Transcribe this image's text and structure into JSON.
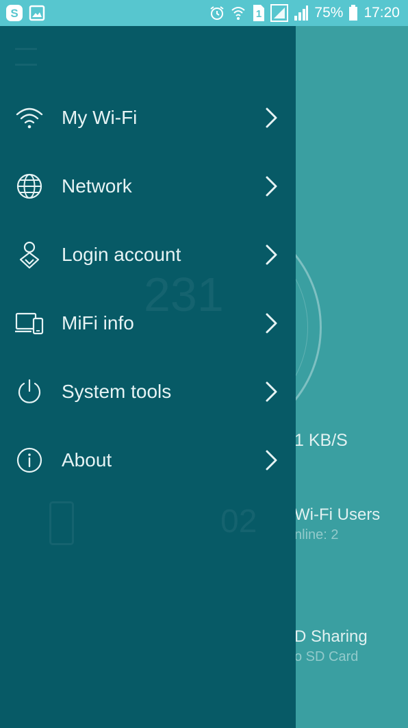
{
  "status_bar": {
    "battery_percent": "75%",
    "time": "17:20",
    "sim_slot": "1",
    "icons": [
      "skype-icon",
      "gallery-icon",
      "alarm-icon",
      "wifi-calling-icon",
      "sim-icon",
      "signal-icon",
      "signal-icon",
      "battery-icon"
    ]
  },
  "background_app": {
    "speed": "1 KB/S",
    "wifi_users_title": "Wi-Fi Users",
    "wifi_users_online": "nline: 2",
    "sd_sharing_title": "D Sharing",
    "sd_sharing_sub": "o SD Card",
    "ghost_number": "231",
    "ghost_count": "02"
  },
  "drawer": {
    "items": [
      {
        "label": "My Wi-Fi",
        "icon": "wifi-icon"
      },
      {
        "label": "Network",
        "icon": "globe-icon"
      },
      {
        "label": "Login account",
        "icon": "user-location-icon"
      },
      {
        "label": "MiFi info",
        "icon": "devices-icon"
      },
      {
        "label": "System tools",
        "icon": "power-icon"
      },
      {
        "label": "About",
        "icon": "info-icon"
      }
    ]
  },
  "colors": {
    "status_bar": "#57c6cf",
    "drawer": "#075a66",
    "app_background": "#3a9fa1",
    "text": "#e6f3f4"
  }
}
